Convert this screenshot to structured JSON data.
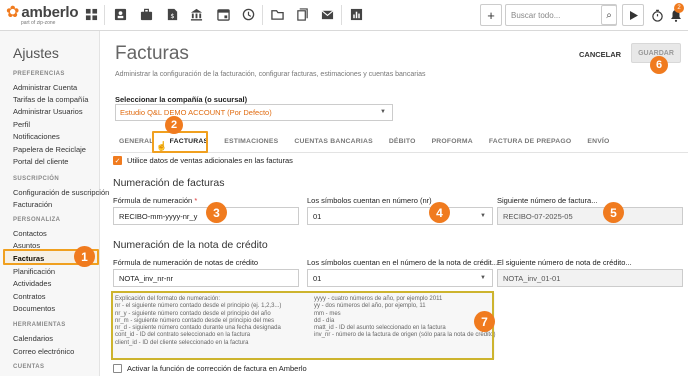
{
  "brand": {
    "name": "amberlo",
    "sub": "part of  zip-zone"
  },
  "topbar": {
    "icons": [
      "dashboard-icon",
      "contact-card-icon",
      "briefcase-icon",
      "document-dollar-icon",
      "bank-icon",
      "calendar-icon",
      "clock-icon",
      "folder-icon",
      "files-icon",
      "mail-icon",
      "bar-chart-icon"
    ],
    "search_placeholder": "Buscar todo...",
    "notif_count": "2"
  },
  "sidebar": {
    "title": "Ajustes",
    "sections": [
      {
        "label": "PREFERENCIAS",
        "items": [
          "Administrar Cuenta",
          "Tarifas de la compañía",
          "Administrar Usuarios",
          "Perfil",
          "Notificaciones",
          "Papelera de Reciclaje",
          "Portal del cliente"
        ]
      },
      {
        "label": "SUSCRIPCIÓN",
        "items": [
          "Configuración de suscripción",
          "Facturación"
        ]
      },
      {
        "label": "PERSONALIZA",
        "items": [
          "Contactos",
          "Asuntos",
          "Facturas",
          "Planificación",
          "Actividades",
          "Contratos",
          "Documentos"
        ]
      },
      {
        "label": "HERRAMIENTAS",
        "items": [
          "Calendarios",
          "Correo electrónico"
        ]
      },
      {
        "label": "CUENTAS",
        "items": []
      }
    ],
    "active": "Facturas"
  },
  "main": {
    "title": "Facturas",
    "subtitle": "Administrar la configuración de la facturación, configurar facturas, estimaciones y cuentas bancarias",
    "cancel": "CANCELAR",
    "save": "GUARDAR",
    "company_label": "Seleccionar la compañía (o sucursal)",
    "company_value": "Estudio Q&L DEMO ACCOUNT (Por Defecto)",
    "tabs": [
      "GENERAL",
      "FACTURAS",
      "ESTIMACIONES",
      "CUENTAS BANCARIAS",
      "DÉBITO",
      "PROFORMA",
      "FACTURA DE PREPAGO",
      "ENVÍO"
    ],
    "active_tab": "FACTURAS",
    "use_extra_label": "Utilice datos de ventas adicionales en las facturas",
    "invoice_section": "Numeración de facturas",
    "f_format_label": "Fórmula de numeración",
    "f_format_value": "RECIBO-mm-yyyy-nr_y",
    "f_symbols_label": "Los símbolos cuentan en número (nr)",
    "f_symbols_value": "01",
    "f_next_label": "Siguiente número de factura...",
    "f_next_value": "RECIBO-07-2025-05",
    "credit_section": "Numeración de la nota de crédito",
    "c_format_label": "Fórmula de numeración de notas de crédito",
    "c_format_value": "NOTA_inv_nr-nr",
    "c_symbols_label": "Los símbolos cuentan en el número de la nota de crédit...",
    "c_symbols_value": "01",
    "c_next_label": "El siguiente número de nota de crédito...",
    "c_next_value": "NOTA_inv_01-01",
    "help_left": [
      "Explicación del formato de numeración:",
      "nr - el siguiente número contado desde el principio (ej. 1,2,3...)",
      "nr_y - siguiente número contado desde el principio del año",
      "nr_m - siguiente número contado desde el principio del mes",
      "nr_d - siguiente número contado durante una fecha designada",
      "cont_id - ID del contrato seleccionado en la factura",
      "client_id - ID del cliente seleccionado en la factura"
    ],
    "help_right": [
      "yyyy - cuatro números de año, por ejemplo 2011",
      "yy - dos números del año, por ejemplo, 11",
      "mm - mes",
      "dd - día",
      "matt_id - ID del asunto seleccionado en la factura",
      "inv_nr - número de la factura de origen (sólo para la nota de crédito)"
    ],
    "correction_label": "Activar la función de corrección de factura en Amberlo"
  },
  "markers": [
    "1",
    "2",
    "3",
    "4",
    "5",
    "6",
    "7"
  ]
}
